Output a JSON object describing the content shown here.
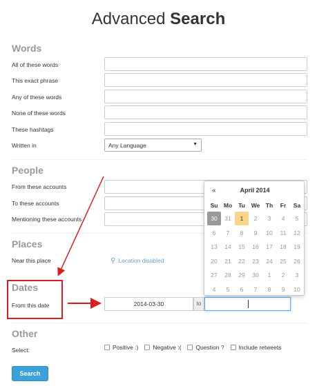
{
  "title": {
    "normal": "Advanced ",
    "bold": "Search"
  },
  "words": {
    "heading": "Words",
    "fields": [
      {
        "label": "All of these words",
        "value": ""
      },
      {
        "label": "This exact phrase",
        "value": ""
      },
      {
        "label": "Any of these words",
        "value": ""
      },
      {
        "label": "None of these words",
        "value": ""
      },
      {
        "label": "These hashtags",
        "value": ""
      }
    ],
    "language_label": "Written in",
    "language_value": "Any Language",
    "language_arrow": "▼"
  },
  "people": {
    "heading": "People",
    "fields": [
      {
        "label": "From these accounts"
      },
      {
        "label": "To these accounts"
      },
      {
        "label": "Mentioning these accounts"
      }
    ]
  },
  "places": {
    "heading": "Places",
    "label": "Near this place",
    "location_text": "Location disabled",
    "pin_icon": "map-pin-icon"
  },
  "dates": {
    "heading": "Dates",
    "label": "From this date",
    "from_value": "2014-03-30",
    "to_label": "to",
    "to_value": ""
  },
  "calendar": {
    "prev": "«",
    "month": "April 2014",
    "weekdays": [
      "Su",
      "Mo",
      "Tu",
      "We",
      "Th",
      "Fr",
      "Sa"
    ],
    "weeks": [
      [
        "30",
        "31",
        "1",
        "2",
        "3",
        "4",
        "5"
      ],
      [
        "6",
        "7",
        "8",
        "9",
        "10",
        "11",
        "12"
      ],
      [
        "13",
        "14",
        "15",
        "16",
        "17",
        "18",
        "19"
      ],
      [
        "20",
        "21",
        "22",
        "23",
        "24",
        "25",
        "26"
      ],
      [
        "27",
        "28",
        "29",
        "30",
        "1",
        "2",
        "3"
      ],
      [
        "4",
        "5",
        "6",
        "7",
        "8",
        "9",
        "10"
      ]
    ],
    "selected": "30",
    "today": "1"
  },
  "other": {
    "heading": "Other",
    "label": "Select:",
    "options": [
      "Positive :)",
      "Negative :(",
      "Question ?",
      "Include retweets"
    ]
  },
  "search_button": "Search",
  "colors": {
    "accent": "#3ba1d8",
    "highlight": "#fcd489",
    "annotation": "#d81e1e"
  }
}
